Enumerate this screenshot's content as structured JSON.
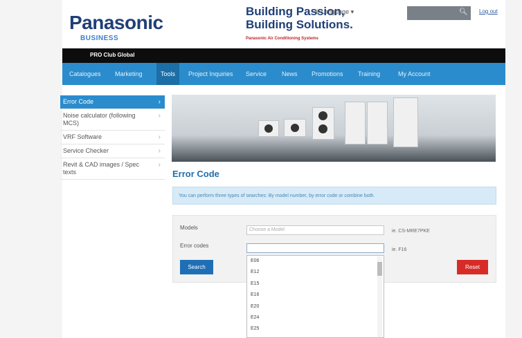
{
  "header": {
    "logo": "Panasonic",
    "logo_sub": "BUSINESS",
    "tagline_line1": "Building Passion,",
    "tagline_line2": "Building Solutions.",
    "tagline_sub": "Panasonic Air Conditioning Systems",
    "language_label": "⊕ Language ▾",
    "logout_label": "Log out"
  },
  "club": "PRO Club Global",
  "nav": {
    "items": [
      "Catalogues",
      "Marketing",
      "Tools",
      "Project Inquiries",
      "Service",
      "News",
      "Promotions",
      "Training",
      "My Account"
    ],
    "active": "Tools"
  },
  "sidebar": {
    "items": [
      {
        "label": "Error Code"
      },
      {
        "label": "Noise calculator (following MCS)"
      },
      {
        "label": "VRF Software"
      },
      {
        "label": "Service Checker"
      },
      {
        "label": "Revit & CAD images / Spec texts"
      }
    ]
  },
  "main": {
    "title": "Error Code",
    "info_text": "You can perform three types of searches: By model number, by error code or combine both.",
    "models_label": "Models",
    "models_placeholder": "Choose a Model",
    "models_hint": "ie. CS-MRE7PKE",
    "error_label": "Error codes",
    "error_value": "",
    "error_hint": "ie. F16",
    "search_button": "Search",
    "reset_button": "Reset"
  },
  "dropdown": {
    "options": [
      "E06",
      "E12",
      "E15",
      "E16",
      "E20",
      "E24",
      "E25"
    ]
  },
  "colors": {
    "brand_blue": "#1f3f77",
    "nav_blue": "#2a8ccc",
    "reset_red": "#d72b27"
  }
}
